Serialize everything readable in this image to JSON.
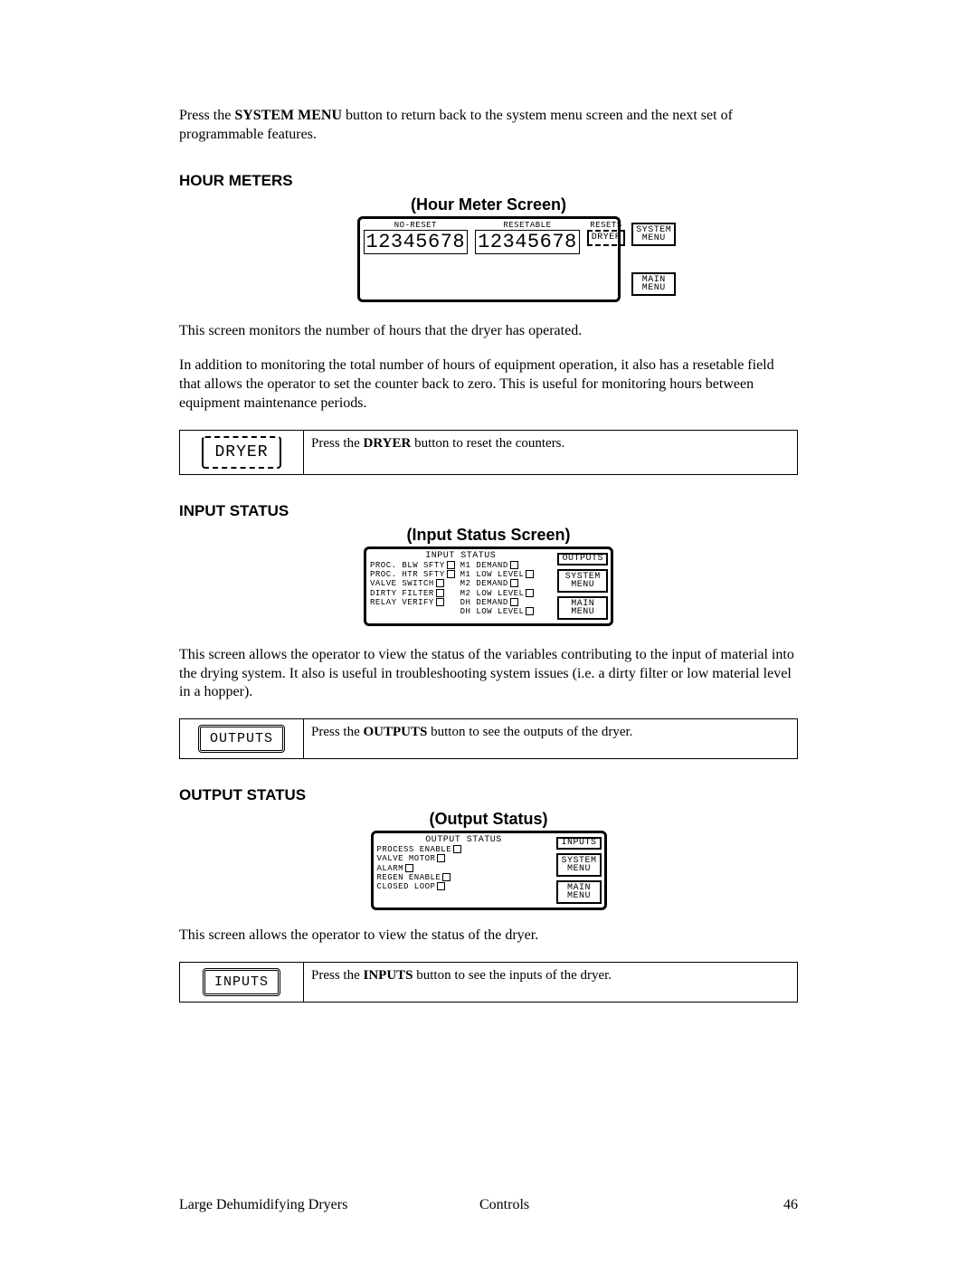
{
  "intro": {
    "pre": "Press the ",
    "bold": "SYSTEM MENU",
    "post": " button to return back to the system menu screen and the next set of programmable features."
  },
  "hourMeters": {
    "heading": "HOUR METERS",
    "caption": "(Hour Meter Screen)",
    "labels": {
      "noReset": "NO-RESET",
      "resetable": "RESETABLE",
      "resets": "RESETS"
    },
    "values": {
      "noReset": "12345678",
      "resetable": "12345678"
    },
    "buttons": {
      "dryer": "DRYER",
      "system": "SYSTEM\nMENU",
      "main": "MAIN\nMENU"
    },
    "para1": "This screen monitors the number of hours that the dryer has operated.",
    "para2": "In addition to monitoring the total number of hours of equipment operation, it also has a resetable field that allows the operator to set the counter back to zero.  This is useful for monitoring hours between equipment maintenance periods.",
    "instr": {
      "icon": "DRYER",
      "pre": "Press the ",
      "bold": "DRYER",
      "post": " button to reset the counters."
    }
  },
  "inputStatus": {
    "heading": "INPUT STATUS",
    "caption": "(Input Status Screen)",
    "title": "INPUT STATUS",
    "left": [
      "PROC. BLW SFTY",
      "PROC. HTR SFTY",
      "VALVE SWITCH",
      "DIRTY FILTER",
      "RELAY VERIFY"
    ],
    "right": [
      "M1 DEMAND",
      "M1 LOW LEVEL",
      "M2 DEMAND",
      "M2 LOW LEVEL",
      "DH DEMAND",
      "DH LOW LEVEL"
    ],
    "buttons": {
      "outputs": "OUTPUTS",
      "system": "SYSTEM\nMENU",
      "main": "MAIN\nMENU"
    },
    "para": "This screen allows the operator to view the status of the variables contributing to the input of material into the drying system.  It also is useful in troubleshooting system issues (i.e. a dirty filter or low material level in a hopper).",
    "instr": {
      "icon": "OUTPUTS",
      "pre": "Press the ",
      "bold": "OUTPUTS",
      "post": " button to see the outputs of the dryer."
    }
  },
  "outputStatus": {
    "heading": "OUTPUT STATUS",
    "caption": "(Output Status)",
    "title": "OUTPUT STATUS",
    "items": [
      "PROCESS ENABLE",
      "VALVE MOTOR",
      "ALARM",
      "REGEN ENABLE",
      "CLOSED LOOP"
    ],
    "buttons": {
      "inputs": "INPUTS",
      "system": "SYSTEM\nMENU",
      "main": "MAIN\nMENU"
    },
    "para": "This screen allows the operator to view the status of the dryer.",
    "instr": {
      "icon": "INPUTS",
      "pre": "Press the ",
      "bold": "INPUTS",
      "post": " button to see the inputs of the dryer."
    }
  },
  "footer": {
    "left": "Large Dehumidifying Dryers",
    "center": "Controls",
    "page": "46"
  }
}
